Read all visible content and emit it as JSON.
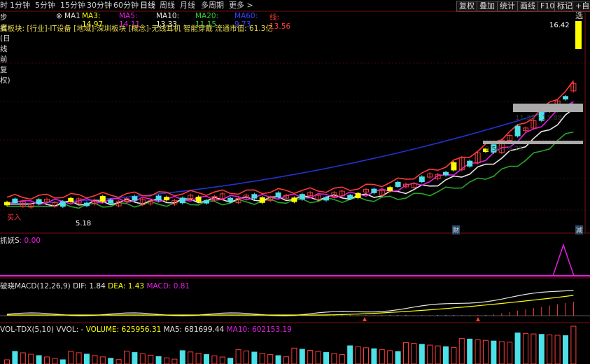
{
  "period_tabs": [
    "时",
    "1分钟",
    "5分钟",
    "15分钟",
    "30分钟",
    "60分钟",
    "日线",
    "周线",
    "月线",
    "多周期",
    "更多 >"
  ],
  "active_tab": "日线",
  "toolbar": [
    "复权",
    "叠加",
    "统计",
    "画线",
    "F10",
    "标记",
    "+自选"
  ],
  "ma_header": {
    "prefix": "步者(日线 前复权)",
    "ma1": "MA1",
    "ma3": "MA3: 14.97",
    "ma5": "MA5: 14.11",
    "ma10": "MA10: 13.33",
    "ma20": "MA20: 11.15",
    "ma60": "MA60: 9.73",
    "extra": "线: 13.56"
  },
  "info_line": "属板块: [行业]-IT设备 [地域]-深圳板块 [概念]-无线耳机 智能穿戴 流通市值: 61.3亿",
  "price_labels": {
    "high": "16.42",
    "low": "5.18",
    "zone1": "11.35 - 11.88",
    "zone2": "9.58 - 9.75",
    "buy": "买入",
    "fin1": "财",
    "fin2": "减"
  },
  "sub1": {
    "name": "抓妖S",
    "value": ": 0.00"
  },
  "macd": {
    "name": "破晓MACD(12,26,9)",
    "dif": "DIF: 1.84",
    "dea": "DEA: 1.43",
    "macd": "MACD: 0.81"
  },
  "vol": {
    "name": "VOL-TDX(5,10)",
    "vvol": "VVOL: -",
    "volume": "VOLUME: 625956.31",
    "ma5": "MA5: 681699.44",
    "ma10": "MA10: 602153.19"
  },
  "colors": {
    "up": "#ff3b3b",
    "down": "#4de0e6",
    "yellow": "#ffff00",
    "magenta": "#e31ee3",
    "green": "#2aa52a",
    "blue": "#2233cc",
    "white": "#e6e6e6"
  }
}
